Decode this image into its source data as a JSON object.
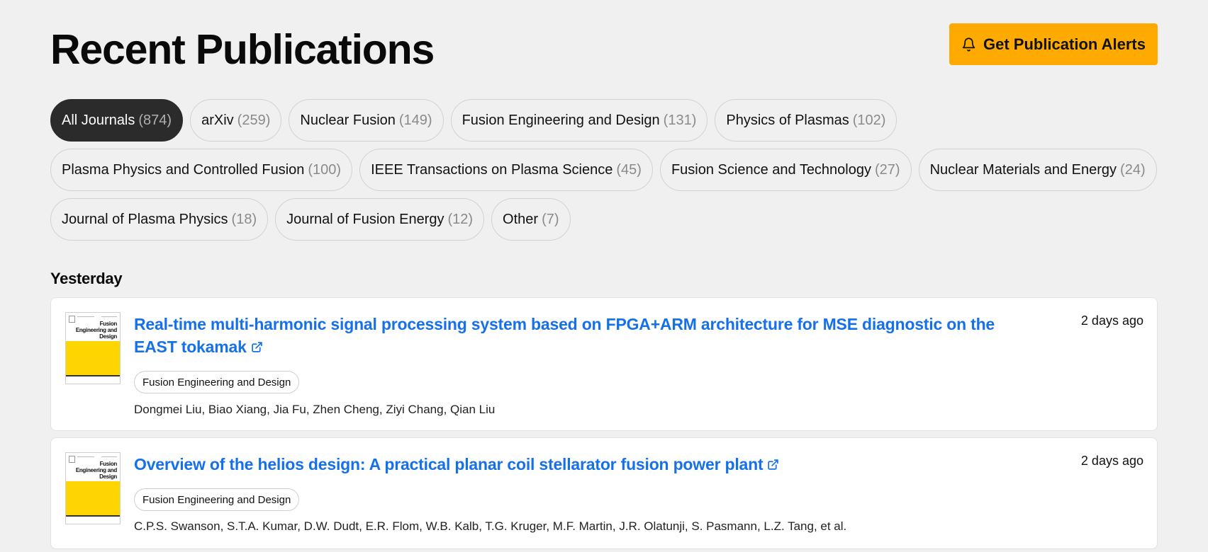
{
  "header": {
    "title": "Recent Publications",
    "alert_button_label": "Get Publication Alerts",
    "alert_button_icon": "bell-icon",
    "accent_color": "#ffaa00"
  },
  "filters": {
    "rows": [
      [
        {
          "label": "All Journals",
          "count": "(874)",
          "active": true
        },
        {
          "label": "arXiv",
          "count": "(259)"
        },
        {
          "label": "Nuclear Fusion",
          "count": "(149)"
        },
        {
          "label": "Fusion Engineering and Design",
          "count": "(131)"
        },
        {
          "label": "Physics of Plasmas",
          "count": "(102)"
        }
      ],
      [
        {
          "label": "Plasma Physics and Controlled Fusion",
          "count": "(100)"
        },
        {
          "label": "IEEE Transactions on Plasma Science",
          "count": "(45)"
        },
        {
          "label": "Fusion Science and Technology",
          "count": "(27)"
        },
        {
          "label": "Nuclear Materials and Energy",
          "count": "(24)"
        }
      ],
      [
        {
          "label": "Journal of Plasma Physics",
          "count": "(18)"
        },
        {
          "label": "Journal of Fusion Energy",
          "count": "(12)"
        },
        {
          "label": "Other",
          "count": "(7)"
        }
      ]
    ]
  },
  "section": {
    "heading": "Yesterday"
  },
  "publications": [
    {
      "title": "Real-time multi-harmonic signal processing system based on FPGA+ARM architecture for MSE diagnostic on the EAST tokamak",
      "time": "2 days ago",
      "journal": "Fusion Engineering and Design",
      "authors": "Dongmei Liu, Biao Xiang, Jia Fu, Zhen Cheng, Ziyi Chang, Qian Liu",
      "cover_journal_name": "Fusion Engineering and Design"
    },
    {
      "title": "Overview of the helios design: A practical planar coil stellarator fusion power plant",
      "time": "2 days ago",
      "journal": "Fusion Engineering and Design",
      "authors": "C.P.S. Swanson, S.T.A. Kumar, D.W. Dudt, E.R. Flom, W.B. Kalb, T.G. Kruger, M.F. Martin, J.R. Olatunji, S. Pasmann, L.Z. Tang, et al.",
      "cover_journal_name": "Fusion Engineering and Design"
    }
  ],
  "colors": {
    "link": "#1670e8",
    "cover_yellow": "#ffd500",
    "active_pill": "#2b2b2b"
  }
}
